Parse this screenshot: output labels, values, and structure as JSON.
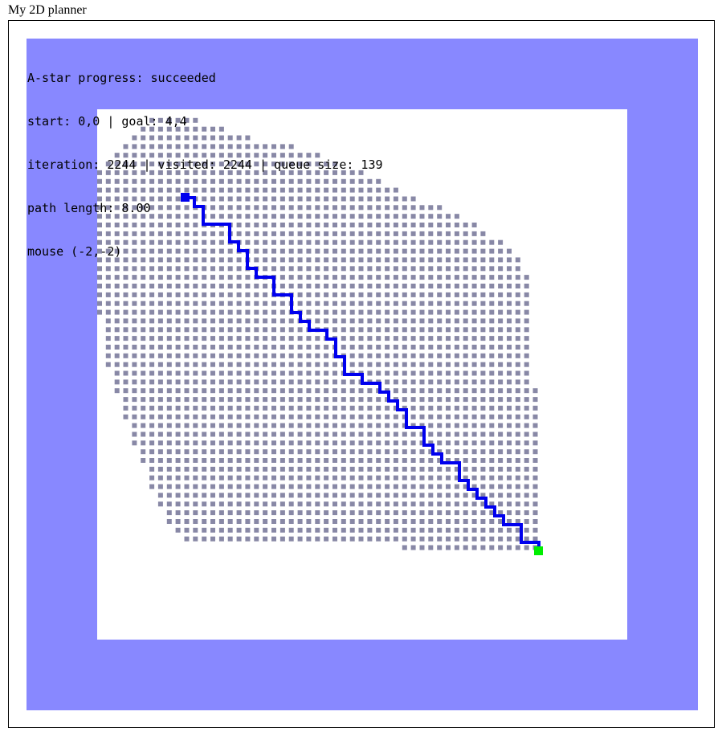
{
  "page": {
    "title": "My 2D planner"
  },
  "status": {
    "progress_line": "A-star progress: succeeded",
    "endpoints_line": "start: 0,0 | goal: 4,4",
    "counters_line": "iteration: 2244 | visited: 2244 | queue size: 139",
    "path_line": "path length: 8.00",
    "mouse_line": "mouse (-2,-2)"
  },
  "colors": {
    "outside_region": "#8888ff",
    "inside_region": "#ffffff",
    "visited_cell": "#8888a6",
    "path": "#0000ee",
    "start_marker": "#0000ee",
    "goal_marker": "#00ee00"
  },
  "map": {
    "start": [
      0,
      0
    ],
    "goal": [
      4,
      4
    ],
    "path_length": 8.0,
    "iteration": 2244,
    "visited": 2244,
    "queue_size": 139,
    "mouse": [
      -2,
      -2
    ]
  }
}
